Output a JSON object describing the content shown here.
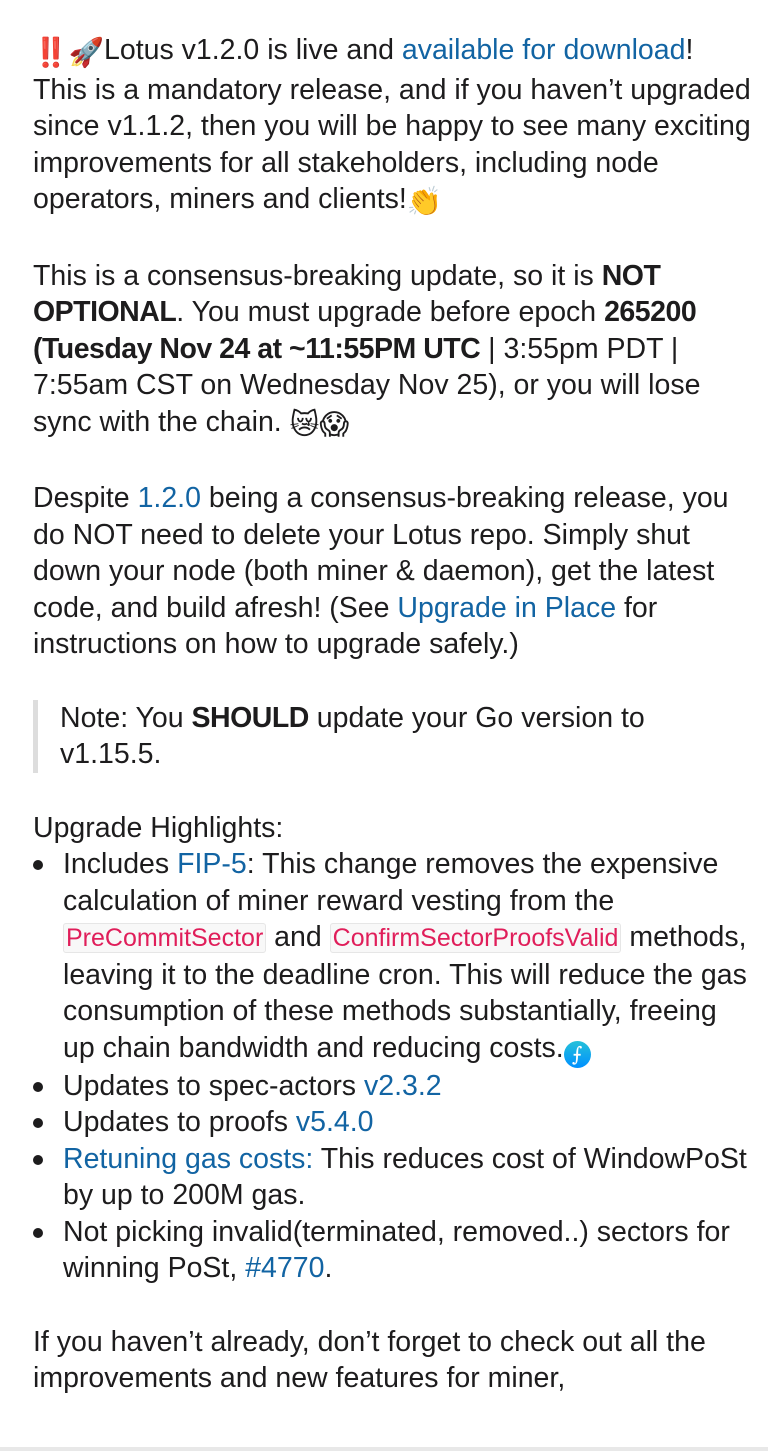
{
  "p1": {
    "emoji_bang": "‼️",
    "emoji_rocket": "🚀",
    "t1": "Lotus v1.2.0 is live and ",
    "link": "available for download",
    "t2": "! This is a mandatory release, and if you haven’t upgraded since v1.1.2, then you will be happy to see many exciting improvements for all stakeholders, including node operators, miners and clients!",
    "emoji_clap": "👏"
  },
  "p2": {
    "t1": "This is a consensus-breaking update, so it is ",
    "b1": "NOT OPTIONAL",
    "t2": ". You must upgrade before epoch ",
    "b2": "265200 (Tuesday Nov 24 at ~11:55PM UTC",
    "t3": " | 3:55pm PDT | 7:55am CST on Wednesday Nov 25), or you will lose sync with the chain. ",
    "emoji_sad": "😿",
    "emoji_scream": "😱"
  },
  "p3": {
    "t1": "Despite ",
    "link1": "1.2.0",
    "t2": " being a consensus-breaking release, you do NOT need to delete your Lotus repo. Simply shut down your node (both miner & daemon), get the latest code, and build afresh! (See ",
    "link2": "Upgrade in Place",
    "t3": " for instructions on how to upgrade safely.)"
  },
  "note": {
    "t1": "Note: You ",
    "b1": "SHOULD",
    "t2": " update your Go version to v1.15.5."
  },
  "highlights": {
    "heading": "Upgrade Highlights:",
    "item1": {
      "t1": "Includes ",
      "link": "FIP-5",
      "t2": ": This change removes the  expensive calculation of miner reward vesting from the ",
      "code1": "PreCommitSector",
      "t3": " and ",
      "code2": "ConfirmSectorProofsValid",
      "t4": " methods, leaving it to the deadline cron. This will reduce the gas consumption of these methods substantially, freeing up chain bandwidth and reducing costs.",
      "emoji": "⨍"
    },
    "item2": {
      "t1": "Updates to spec-actors ",
      "link": "v2.3.2"
    },
    "item3": {
      "t1": "Updates to proofs ",
      "link": "v5.4.0"
    },
    "item4": {
      "link": "Retuning gas costs:",
      "t1": "  This reduces cost of WindowPoSt by up to 200M gas."
    },
    "item5": {
      "t1": "Not picking invalid(terminated, removed..) sectors for winning PoSt, ",
      "link": "#4770",
      "t2": "."
    }
  },
  "p4": {
    "t1": "If you haven’t already, don’t forget to check out all the improvements and new features for miner,"
  }
}
